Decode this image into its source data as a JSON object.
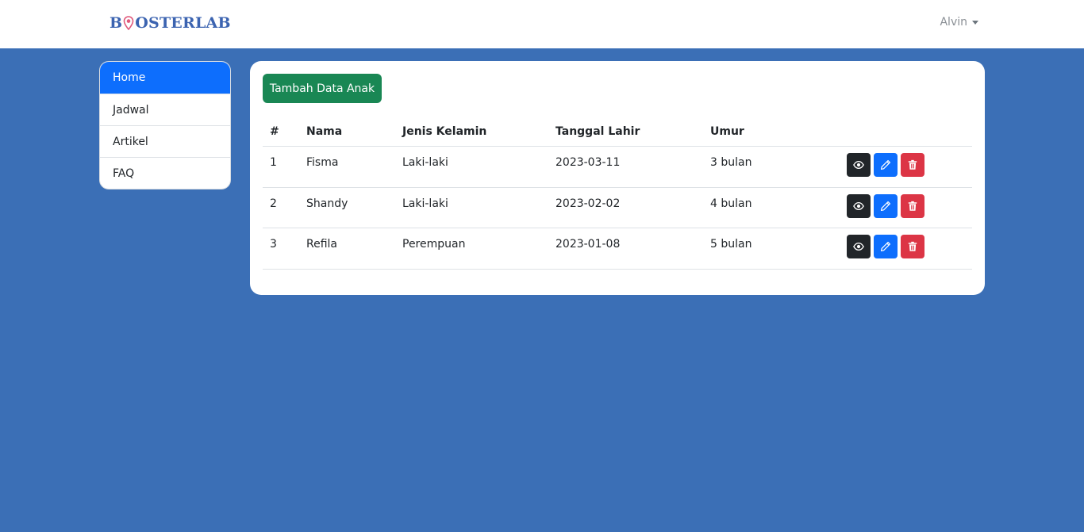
{
  "navbar": {
    "brand_prefix": "B",
    "brand_suffix": "OSTERLAB",
    "user_name": "Alvin",
    "brand_color": "#3b63b0"
  },
  "sidebar": {
    "items": [
      {
        "label": "Home",
        "active": true
      },
      {
        "label": "Jadwal"
      },
      {
        "label": "Artikel"
      },
      {
        "label": "FAQ"
      }
    ]
  },
  "main": {
    "add_button_label": "Tambah Data Anak",
    "table": {
      "headers": [
        "#",
        "Nama",
        "Jenis Kelamin",
        "Tanggal Lahir",
        "Umur"
      ],
      "rows": [
        {
          "num": "1",
          "nama": "Fisma",
          "jenis_kelamin": "Laki-laki",
          "tanggal_lahir": "2023-03-11",
          "umur": "3 bulan"
        },
        {
          "num": "2",
          "nama": "Shandy",
          "jenis_kelamin": "Laki-laki",
          "tanggal_lahir": "2023-02-02",
          "umur": "4 bulan"
        },
        {
          "num": "3",
          "nama": "Refila",
          "jenis_kelamin": "Perempuan",
          "tanggal_lahir": "2023-01-08",
          "umur": "5 bulan"
        }
      ]
    }
  },
  "icons": {
    "view": "eye-icon",
    "edit": "pencil-icon",
    "delete": "trash-icon",
    "logo_pin": "location-pin-icon"
  },
  "colors": {
    "background": "#3b6fb6",
    "primary": "#0d6efd",
    "success": "#198754",
    "danger": "#dc3545",
    "dark": "#212529"
  }
}
